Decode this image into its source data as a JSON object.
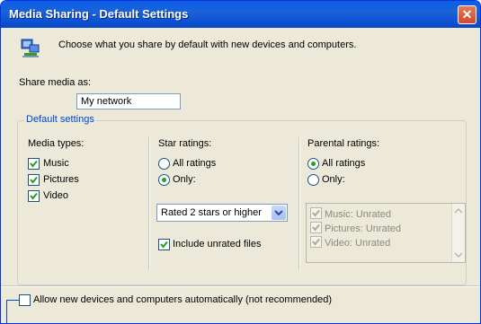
{
  "window": {
    "title": "Media Sharing - Default Settings",
    "close_label": "✕"
  },
  "intro": "Choose what you share by default with new devices and computers.",
  "share_as": {
    "label": "Share media as:",
    "value": "My network"
  },
  "group": {
    "legend": "Default settings",
    "media_types": {
      "label": "Media types:",
      "items": [
        {
          "label": "Music",
          "checked": true
        },
        {
          "label": "Pictures",
          "checked": true
        },
        {
          "label": "Video",
          "checked": true
        }
      ]
    },
    "star_ratings": {
      "label": "Star ratings:",
      "all": "All ratings",
      "only": "Only:",
      "selected": "only",
      "dropdown_value": "Rated 2 stars or higher",
      "include_unrated": "Include unrated files"
    },
    "parental": {
      "label": "Parental ratings:",
      "all": "All ratings",
      "only": "Only:",
      "selected": "all",
      "list": [
        "Music: Unrated",
        "Pictures: Unrated",
        "Video: Unrated"
      ]
    }
  },
  "allow_new": "Allow new devices and computers automatically (not recommended)",
  "colors": {
    "title_bar": "#0a5ee8",
    "dialog_bg": "#ece9d8",
    "legend": "#0046d5",
    "check": "#21a121"
  }
}
